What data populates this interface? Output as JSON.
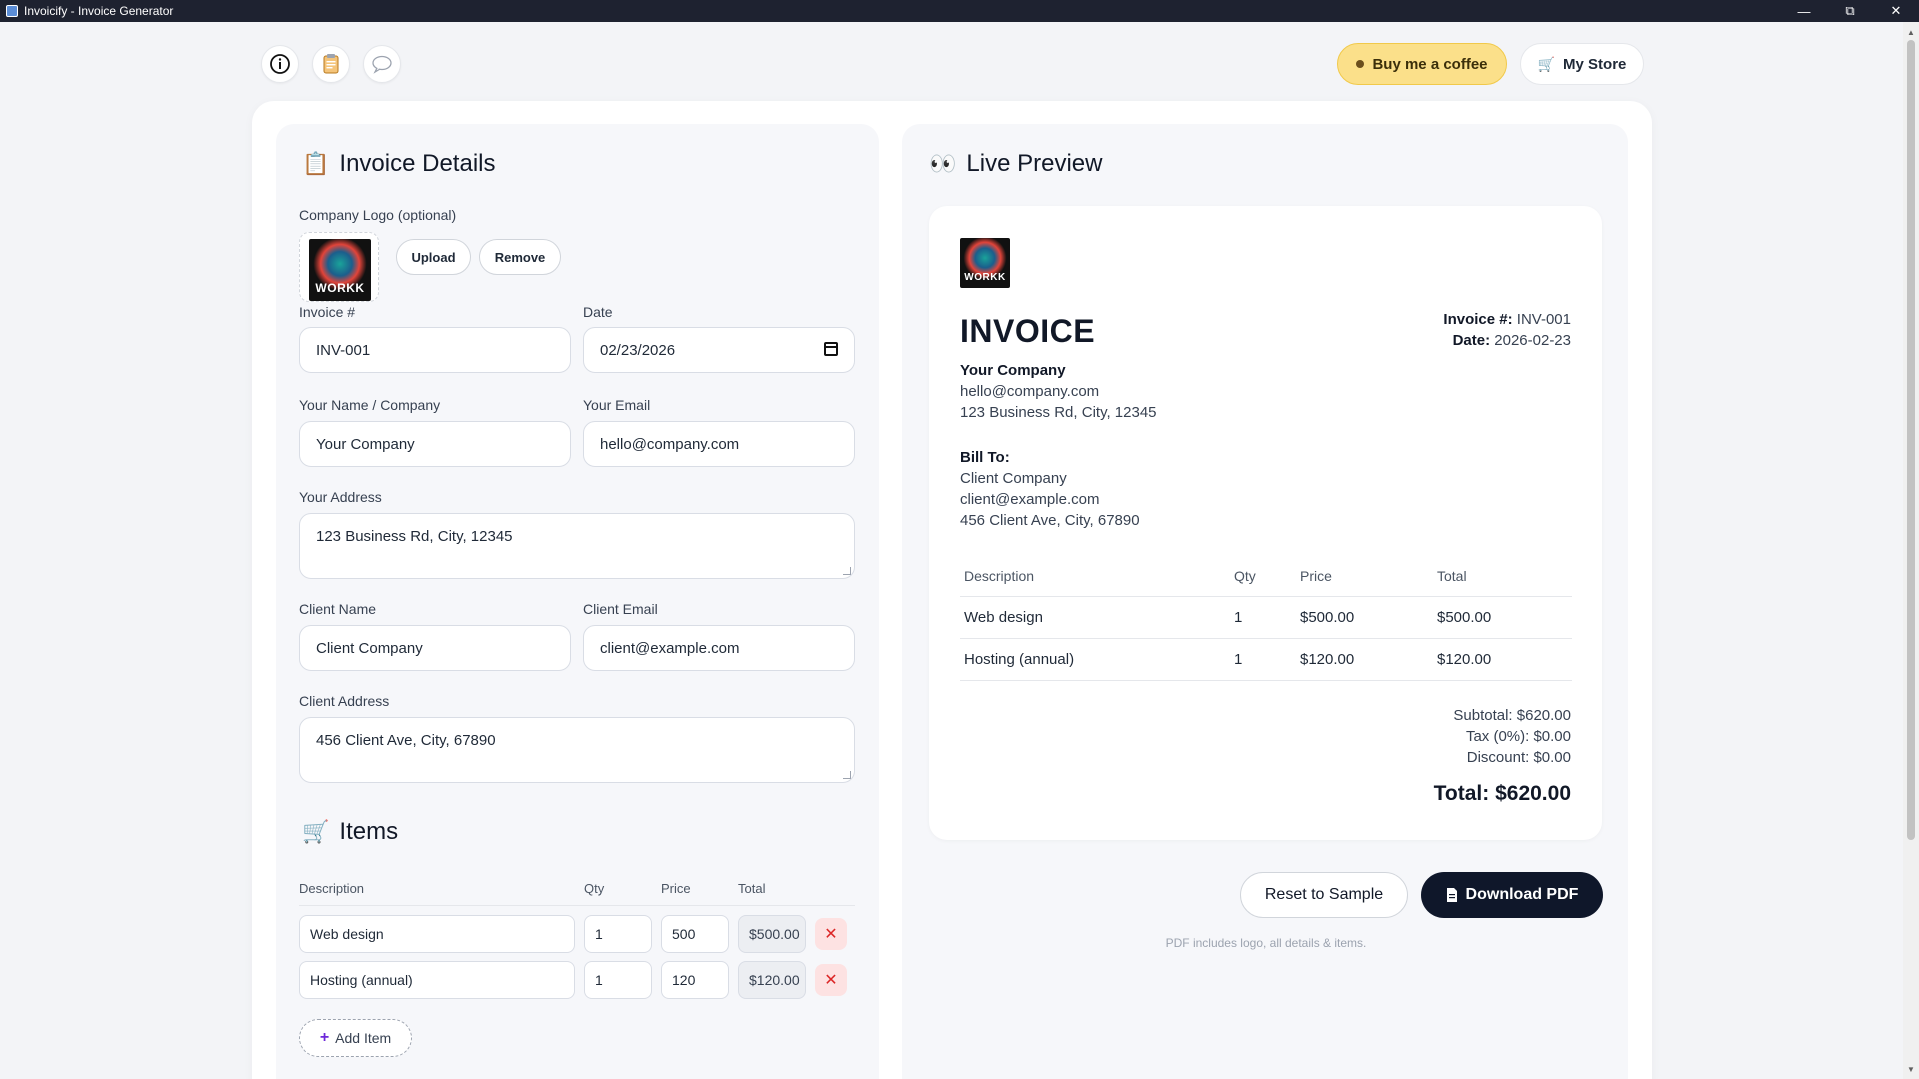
{
  "window": {
    "title": "Invoicify - Invoice Generator"
  },
  "topbar": {
    "coffee_label": "Buy me a coffee",
    "store_label": "My Store"
  },
  "form": {
    "title": "Invoice Details",
    "logo_label": "Company Logo (optional)",
    "logo_text": "WORKK",
    "upload_label": "Upload",
    "remove_label": "Remove",
    "invoice_no_label": "Invoice #",
    "invoice_no": "INV-001",
    "date_label": "Date",
    "date": "02/23/2026",
    "your_name_label": "Your Name / Company",
    "your_name": "Your Company",
    "your_email_label": "Your Email",
    "your_email": "hello@company.com",
    "your_address_label": "Your Address",
    "your_address": "123 Business Rd, City, 12345",
    "client_name_label": "Client Name",
    "client_name": "Client Company",
    "client_email_label": "Client Email",
    "client_email": "client@example.com",
    "client_address_label": "Client Address",
    "client_address": "456 Client Ave, City, 67890"
  },
  "items": {
    "title": "Items",
    "headers": {
      "description": "Description",
      "qty": "Qty",
      "price": "Price",
      "total": "Total"
    },
    "rows": [
      {
        "description": "Web design",
        "qty": "1",
        "price": "500",
        "total": "$500.00"
      },
      {
        "description": "Hosting (annual)",
        "qty": "1",
        "price": "120",
        "total": "$120.00"
      }
    ],
    "add_label": "Add Item"
  },
  "preview": {
    "title": "Live Preview",
    "logo_text": "WORKK",
    "heading": "INVOICE",
    "invoice_no_label": "Invoice #:",
    "invoice_no": "INV-001",
    "date_label": "Date:",
    "date": "2026-02-23",
    "from_name": "Your Company",
    "from_email": "hello@company.com",
    "from_address": "123 Business Rd, City, 12345",
    "bill_to_label": "Bill To:",
    "to_name": "Client Company",
    "to_email": "client@example.com",
    "to_address": "456 Client Ave, City, 67890",
    "table_headers": {
      "description": "Description",
      "qty": "Qty",
      "price": "Price",
      "total": "Total"
    },
    "rows": [
      {
        "description": "Web design",
        "qty": "1",
        "price": "$500.00",
        "total": "$500.00"
      },
      {
        "description": "Hosting (annual)",
        "qty": "1",
        "price": "$120.00",
        "total": "$120.00"
      }
    ],
    "subtotal": "Subtotal: $620.00",
    "tax": "Tax (0%): $0.00",
    "discount": "Discount: $0.00",
    "total": "Total: $620.00"
  },
  "actions": {
    "reset_label": "Reset to Sample",
    "download_label": "Download PDF",
    "pdf_note": "PDF includes logo, all details & items."
  }
}
